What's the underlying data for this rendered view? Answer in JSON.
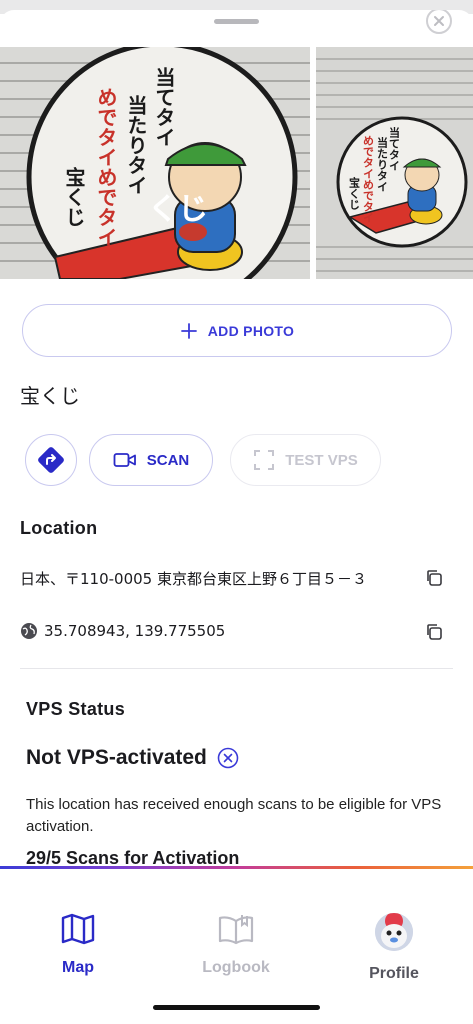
{
  "photos": {
    "sign_text": {
      "line1": "当てタイ",
      "line2": "当たりタイ",
      "line3": "めでタイめでタイ",
      "line4": "宝くじ",
      "mat": "くじ"
    }
  },
  "actions": {
    "add_photo_label": "ADD PHOTO",
    "scan_label": "SCAN",
    "test_vps_label": "TEST VPS"
  },
  "place": {
    "name": "宝くじ"
  },
  "location": {
    "title": "Location",
    "address": "日本、〒110-0005 東京都台東区上野６丁目５－３",
    "coordinates": "35.708943, 139.775505"
  },
  "vps": {
    "title": "VPS Status",
    "status": "Not VPS-activated",
    "description": "This location has received enough scans to be eligible for VPS activation.",
    "scans": "29/5 Scans for Activation"
  },
  "tabs": {
    "map": "Map",
    "logbook": "Logbook",
    "profile": "Profile"
  },
  "colors": {
    "accent": "#2a2ac7",
    "disabled": "#c6c6cf"
  }
}
